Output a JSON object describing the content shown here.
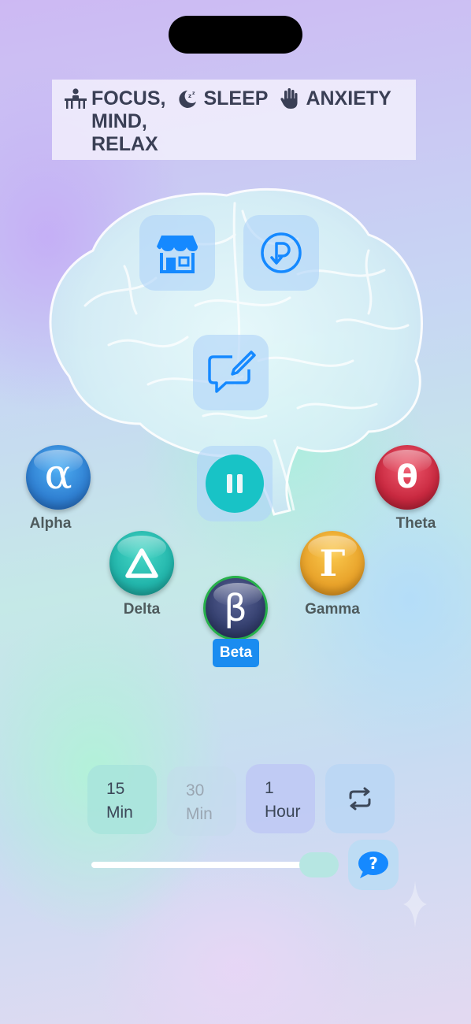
{
  "modes": [
    {
      "icon": "desk-person-icon",
      "label": "FOCUS,\nMIND,\nRELAX"
    },
    {
      "icon": "moon-sleep-icon",
      "label": "SLEEP"
    },
    {
      "icon": "raised-hand-icon",
      "label": "ANXIETY"
    }
  ],
  "actions": {
    "store_icon": "storefront-icon",
    "restore_icon": "restore-purchase-icon",
    "feedback_icon": "feedback-edit-icon",
    "pause_icon": "pause-icon"
  },
  "waves": {
    "alpha": {
      "label": "Alpha",
      "glyph": "α",
      "color": "#2f7fd1"
    },
    "theta": {
      "label": "Theta",
      "glyph": "θ",
      "color": "#c8283f"
    },
    "delta": {
      "label": "Delta",
      "glyph": "Δ",
      "color": "#22b5ab"
    },
    "gamma": {
      "label": "Gamma",
      "glyph": "Γ",
      "color": "#e8a22a"
    },
    "beta": {
      "label": "Beta",
      "glyph": "β",
      "color": "#343f6e",
      "selected": true
    }
  },
  "timer": {
    "options": [
      {
        "line1": "15",
        "line2": "Min",
        "state": "selected"
      },
      {
        "line1": "30",
        "line2": "Min",
        "state": "disabled"
      },
      {
        "line1": "1",
        "line2": "Hour",
        "state": "normal"
      }
    ],
    "repeat_icon": "repeat-icon"
  },
  "volume": {
    "level": 0.9
  },
  "help_icon": "help-bubble-icon"
}
